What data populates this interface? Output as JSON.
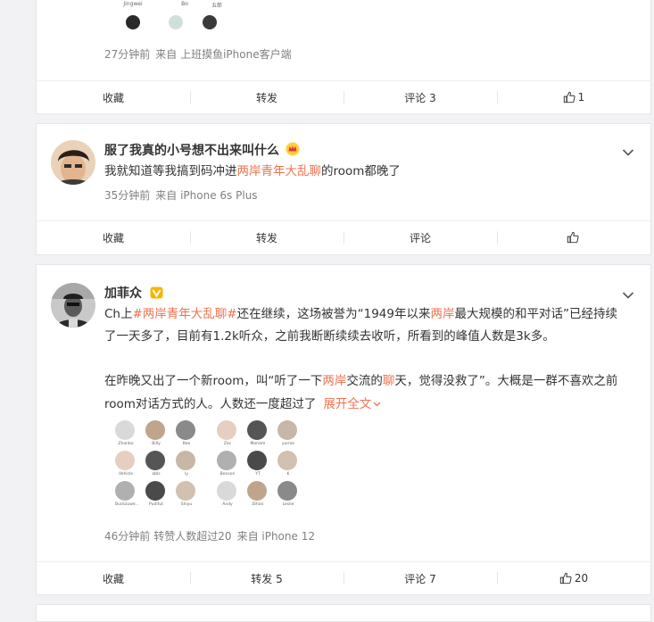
{
  "post1": {
    "grid_names": [
      "Jingwei",
      "Bo",
      "五郎"
    ],
    "meta": {
      "time": "27分钟前",
      "from": "来自 上班摸鱼iPhone客户端"
    },
    "actions": {
      "favorite": "收藏",
      "repost": "转发",
      "comment": "评论 3",
      "like_count": "1"
    }
  },
  "post2": {
    "author": "服了我真的小号想不出来叫什么",
    "text_before": "我就知道等我搞到码冲进",
    "text_highlight": "两岸青年大乱聊",
    "text_after": "的room都晚了",
    "meta": {
      "time": "35分钟前",
      "from": "来自 iPhone 6s Plus"
    },
    "actions": {
      "favorite": "收藏",
      "repost": "转发",
      "comment": "评论",
      "like_count": ""
    }
  },
  "post3": {
    "author": "加菲众",
    "line1_a": "Ch上",
    "line1_tag": "#两岸青年大乱聊#",
    "line1_b": "还在继续，这场被誉为“1949年以来",
    "line1_hl": "两岸",
    "line1_c": "最大规模的和平对话”已经持续",
    "line2": "了一天多了，目前有1.2k听众，之前我断断续续去收听，所看到的峰值人数是3k多。",
    "line3_a": "在昨晚又出了一个新room，叫“听了一下",
    "line3_hl1": "两岸",
    "line3_b": "交流的",
    "line3_hl2": "聊",
    "line3_c": "天，觉得没救了”。大概是一群不喜欢之前",
    "line4": "room对话方式的人。人数还一度超过了",
    "expand": "展开全文",
    "grid_left": [
      "Zhanbo",
      "Billy",
      "Bee",
      "Vehicle",
      "abls",
      "Iy",
      "Buckzuwe...",
      "Puditut",
      "Shiyu"
    ],
    "grid_right": [
      "Zac",
      "Mariam",
      "yurnie",
      "Benson",
      "YT",
      "K",
      "Andy",
      "Ethan",
      "Leslie"
    ],
    "meta": {
      "time": "46分钟前",
      "repost_info": "转赞人数超过20",
      "from": "来自 iPhone 12"
    },
    "actions": {
      "favorite": "收藏",
      "repost": "转发 5",
      "comment": "评论 7",
      "like_count": "20"
    }
  },
  "colors": {
    "accent": "#eb7350",
    "background": "#f2f2f5",
    "verified": "#f7b500"
  }
}
